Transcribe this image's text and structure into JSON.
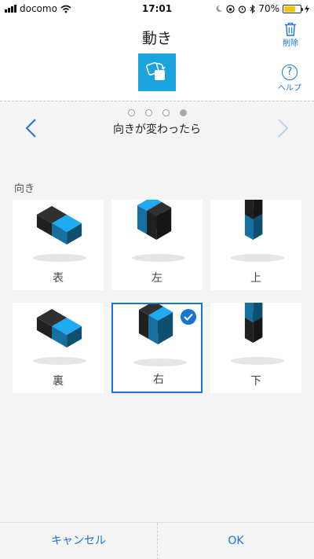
{
  "status": {
    "carrier": "docomo",
    "time": "17:01",
    "battery": "70%",
    "battery_level": 0.7
  },
  "header": {
    "title": "動き",
    "delete_label": "削除",
    "help_label": "ヘルプ",
    "help_glyph": "?"
  },
  "pager": {
    "count": 4,
    "active_index": 3
  },
  "nav": {
    "title": "向きが変わったら"
  },
  "section": {
    "label": "向き"
  },
  "orientations": [
    {
      "label": "表",
      "block": "face-up",
      "selected": false
    },
    {
      "label": "左",
      "block": "left",
      "selected": false
    },
    {
      "label": "上",
      "block": "up",
      "selected": false
    },
    {
      "label": "裏",
      "block": "face-down",
      "selected": false
    },
    {
      "label": "右",
      "block": "right",
      "selected": true
    },
    {
      "label": "下",
      "block": "down",
      "selected": false
    }
  ],
  "footer": {
    "cancel_label": "キャンセル",
    "ok_label": "OK"
  },
  "colors": {
    "accent": "#1a73d9",
    "brand": "#1aa3dc",
    "block_dark": "#2c2c2c",
    "block_blue": "#1e9de0"
  }
}
